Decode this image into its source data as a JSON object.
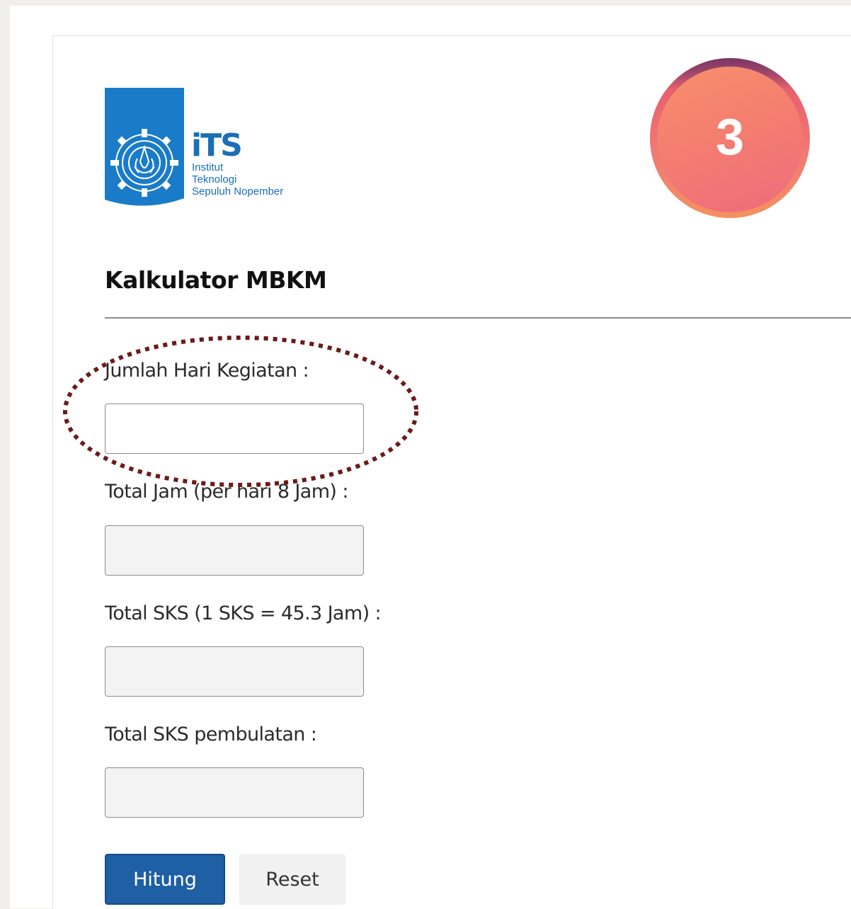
{
  "logo": {
    "wordmark": "iTS",
    "line1": "Institut",
    "line2": "Teknologi",
    "line3": "Sepuluh Nopember"
  },
  "step_badge": {
    "number": "3"
  },
  "page": {
    "title": "Kalkulator MBKM"
  },
  "form": {
    "fields": [
      {
        "label": "Jumlah Hari Kegiatan :",
        "value": ""
      },
      {
        "label": "Total Jam (per hari 8 Jam) :",
        "value": ""
      },
      {
        "label": "Total SKS (1 SKS = 45.3 Jam) :",
        "value": ""
      },
      {
        "label": "Total SKS pembulatan :",
        "value": ""
      }
    ],
    "submit_label": "Hitung",
    "reset_label": "Reset"
  },
  "colors": {
    "primary_button": "#1f5fa4",
    "logo_blue": "#1a6fb5",
    "highlight_ring": "#6b1a1a",
    "badge_gradient": "#f47e70"
  }
}
